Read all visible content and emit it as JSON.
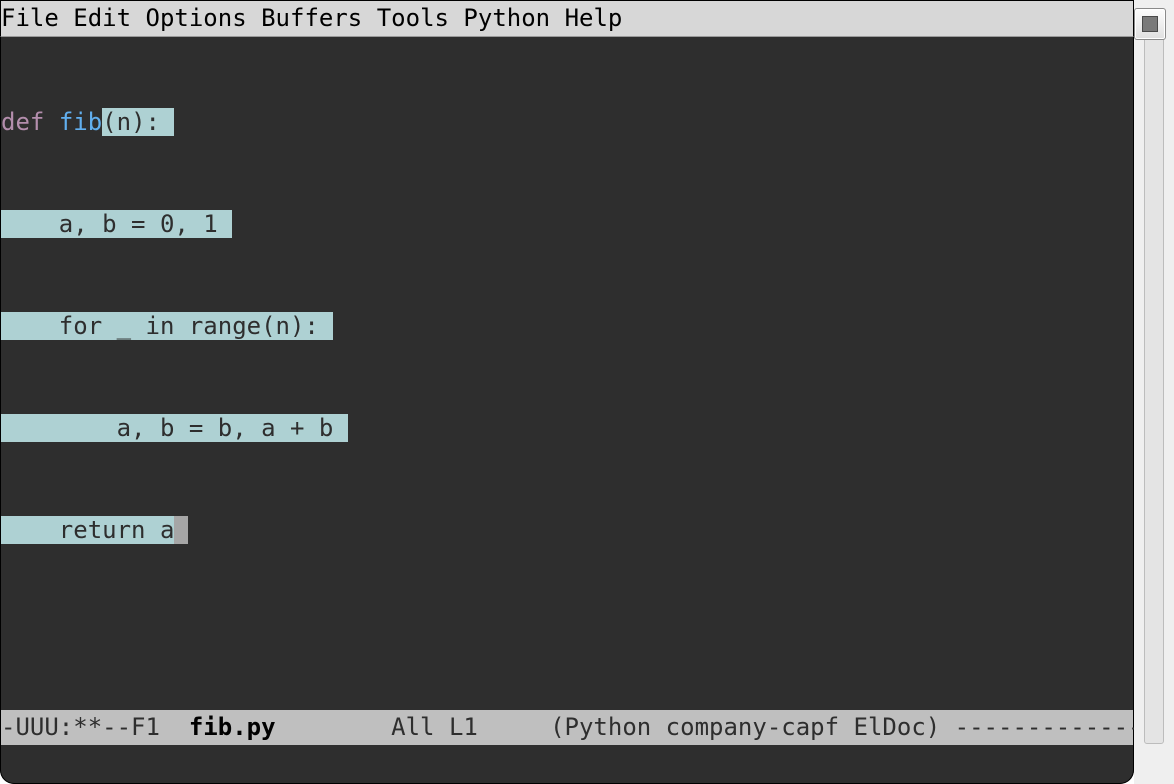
{
  "menu": {
    "items": [
      "File",
      "Edit",
      "Options",
      "Buffers",
      "Tools",
      "Python",
      "Help"
    ]
  },
  "code": {
    "line1_def": "def",
    "line1_sp1": " ",
    "line1_fn": "fib",
    "line1_rest": "(n):",
    "line1_trail": " ",
    "line2_pre": "    ",
    "line2_body": "a, b = 0, 1 ",
    "line3_pre": "    ",
    "line3_body": "for _ in range(n): ",
    "line4_pre": "        ",
    "line4_body": "a, b = b, a + b ",
    "line5_pre": "    ",
    "line5_body": "return a"
  },
  "modeline": {
    "left": "-UUU:**--F1  ",
    "bufname": "fib.py",
    "mid": "        All L1     (Python company-capf ElDoc) -------------"
  }
}
